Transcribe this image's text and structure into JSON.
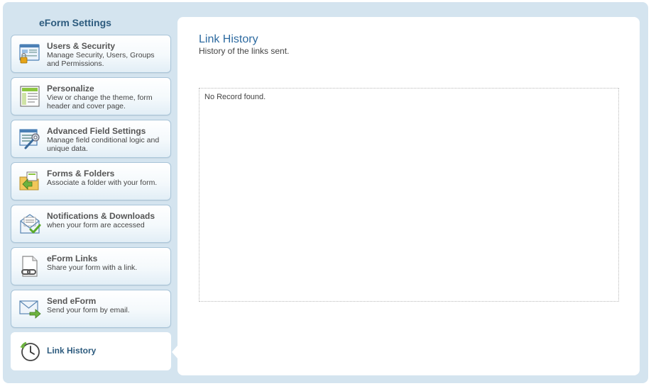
{
  "sidebar": {
    "title": "eForm Settings",
    "items": [
      {
        "id": "users-security",
        "label": "Users & Security",
        "description": "Manage Security, Users, Groups and Permissions.",
        "icon": "users-security-icon"
      },
      {
        "id": "personalize",
        "label": "Personalize",
        "description": "View or change the theme, form header and cover page.",
        "icon": "personalize-icon"
      },
      {
        "id": "advanced-field-settings",
        "label": "Advanced Field Settings",
        "description": "Manage field conditional logic and unique data.",
        "icon": "advanced-field-settings-icon"
      },
      {
        "id": "forms-folders",
        "label": "Forms & Folders",
        "description": "Associate a folder with your form.",
        "icon": "folder-icon"
      },
      {
        "id": "notifications-downloads",
        "label": "Notifications & Downloads",
        "description": "when your form are accessed",
        "icon": "notification-envelope-icon"
      },
      {
        "id": "eform-links",
        "label": "eForm Links",
        "description": "Share your form with a link.",
        "icon": "document-link-icon"
      },
      {
        "id": "send-eform",
        "label": "Send eForm",
        "description": "Send your form by email.",
        "icon": "send-envelope-icon"
      },
      {
        "id": "link-history",
        "label": "Link History",
        "description": "",
        "icon": "history-clock-icon",
        "active": true
      }
    ]
  },
  "main": {
    "title": "Link History",
    "subtitle": "History of the links sent.",
    "empty_message": "No Record found."
  },
  "colors": {
    "frame_bg": "#d4e4ef",
    "accent_title": "#2d5b7e",
    "link_blue": "#2d6aa0"
  }
}
